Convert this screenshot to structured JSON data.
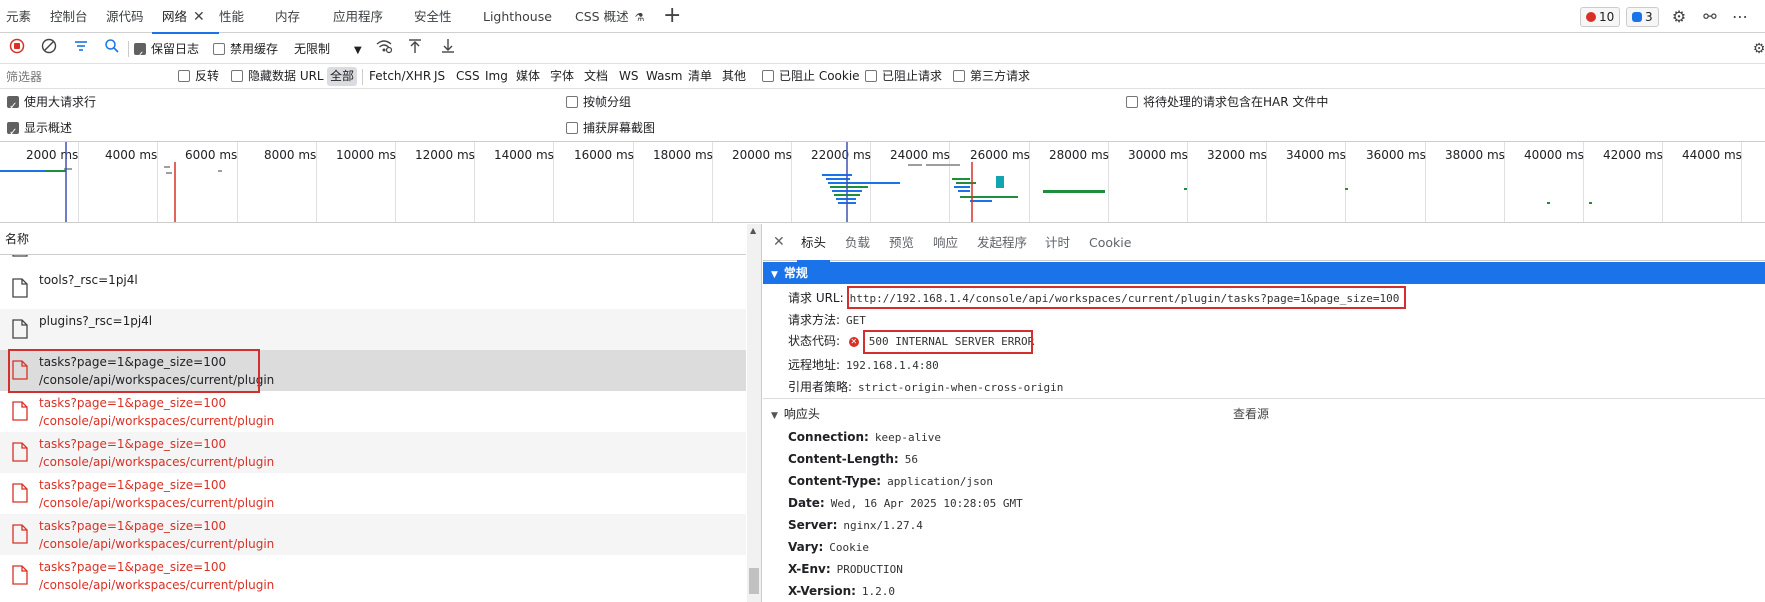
{
  "tabs": [
    {
      "label": "元素"
    },
    {
      "label": "控制台"
    },
    {
      "label": "源代码"
    },
    {
      "label": "网络",
      "close": "✕"
    },
    {
      "label": "性能"
    },
    {
      "label": "内存"
    },
    {
      "label": "应用程序"
    },
    {
      "label": "安全性"
    },
    {
      "label": "Lighthouse"
    },
    {
      "label": "CSS 概述"
    }
  ],
  "badges": {
    "errors": "10",
    "messages": "3",
    "error_color": "#d93025",
    "message_color": "#1a73e8"
  },
  "toolbar": {
    "preserve_log": "保留日志",
    "disable_cache": "禁用缓存",
    "throttle": "无限制"
  },
  "filter": {
    "placeholder": "筛选器",
    "invert": "反转",
    "hide_data_url": "隐藏数据 URL",
    "types": [
      "全部",
      "Fetch/XHR",
      "JS",
      "CSS",
      "Img",
      "媒体",
      "字体",
      "文档",
      "WS",
      "Wasm",
      "清单",
      "其他"
    ],
    "blocked_cookies": "已阻止 Cookie",
    "blocked_requests": "已阻止请求",
    "third_party": "第三方请求"
  },
  "options": {
    "big_rows": "使用大请求行",
    "group_by_frame": "按帧分组",
    "har_pending": "将待处理的请求包含在HAR 文件中",
    "show_overview": "显示概述",
    "capture_screenshots": "捕获屏幕截图"
  },
  "timeline": {
    "ticks": [
      "2000 ms",
      "4000 ms",
      "6000 ms",
      "8000 ms",
      "10000 ms",
      "12000 ms",
      "14000 ms",
      "16000 ms",
      "18000 ms",
      "20000 ms",
      "22000 ms",
      "24000 ms",
      "26000 ms",
      "28000 ms",
      "30000 ms",
      "32000 ms",
      "34000 ms",
      "36000 ms",
      "38000 ms",
      "40000 ms",
      "42000 ms",
      "44000 ms"
    ]
  },
  "list": {
    "header": "名称",
    "rows": [
      {
        "name": "tools?_rsc=1pj4l",
        "path": "",
        "error": false
      },
      {
        "name": "plugins?_rsc=1pj4l",
        "path": "",
        "error": false
      },
      {
        "name": "tasks?page=1&page_size=100",
        "path": "/console/api/workspaces/current/plugin",
        "error": false,
        "selected": true
      },
      {
        "name": "tasks?page=1&page_size=100",
        "path": "/console/api/workspaces/current/plugin",
        "error": true
      },
      {
        "name": "tasks?page=1&page_size=100",
        "path": "/console/api/workspaces/current/plugin",
        "error": true
      },
      {
        "name": "tasks?page=1&page_size=100",
        "path": "/console/api/workspaces/current/plugin",
        "error": true
      },
      {
        "name": "tasks?page=1&page_size=100",
        "path": "/console/api/workspaces/current/plugin",
        "error": true
      },
      {
        "name": "tasks?page=1&page_size=100",
        "path": "/console/api/workspaces/current/plugin",
        "error": true
      }
    ]
  },
  "detail": {
    "tabs": [
      "标头",
      "负载",
      "预览",
      "响应",
      "发起程序",
      "计时",
      "Cookie"
    ],
    "general_title": "常规",
    "general": [
      {
        "k": "请求 URL:",
        "v": "http://192.168.1.4/console/api/workspaces/current/plugin/tasks?page=1&page_size=100"
      },
      {
        "k": "请求方法:",
        "v": "GET"
      },
      {
        "k": "状态代码:",
        "v": "500 INTERNAL SERVER ERROR"
      },
      {
        "k": "远程地址:",
        "v": "192.168.1.4:80"
      },
      {
        "k": "引用者策略:",
        "v": "strict-origin-when-cross-origin"
      }
    ],
    "response_title": "响应头",
    "view_source": "查看源",
    "response": [
      {
        "k": "Connection:",
        "v": "keep-alive"
      },
      {
        "k": "Content-Length:",
        "v": "56"
      },
      {
        "k": "Content-Type:",
        "v": "application/json"
      },
      {
        "k": "Date:",
        "v": "Wed, 16 Apr 2025 10:28:05 GMT"
      },
      {
        "k": "Server:",
        "v": "nginx/1.27.4"
      },
      {
        "k": "Vary:",
        "v": "Cookie"
      },
      {
        "k": "X-Env:",
        "v": "PRODUCTION"
      },
      {
        "k": "X-Version:",
        "v": "1.2.0"
      }
    ]
  }
}
